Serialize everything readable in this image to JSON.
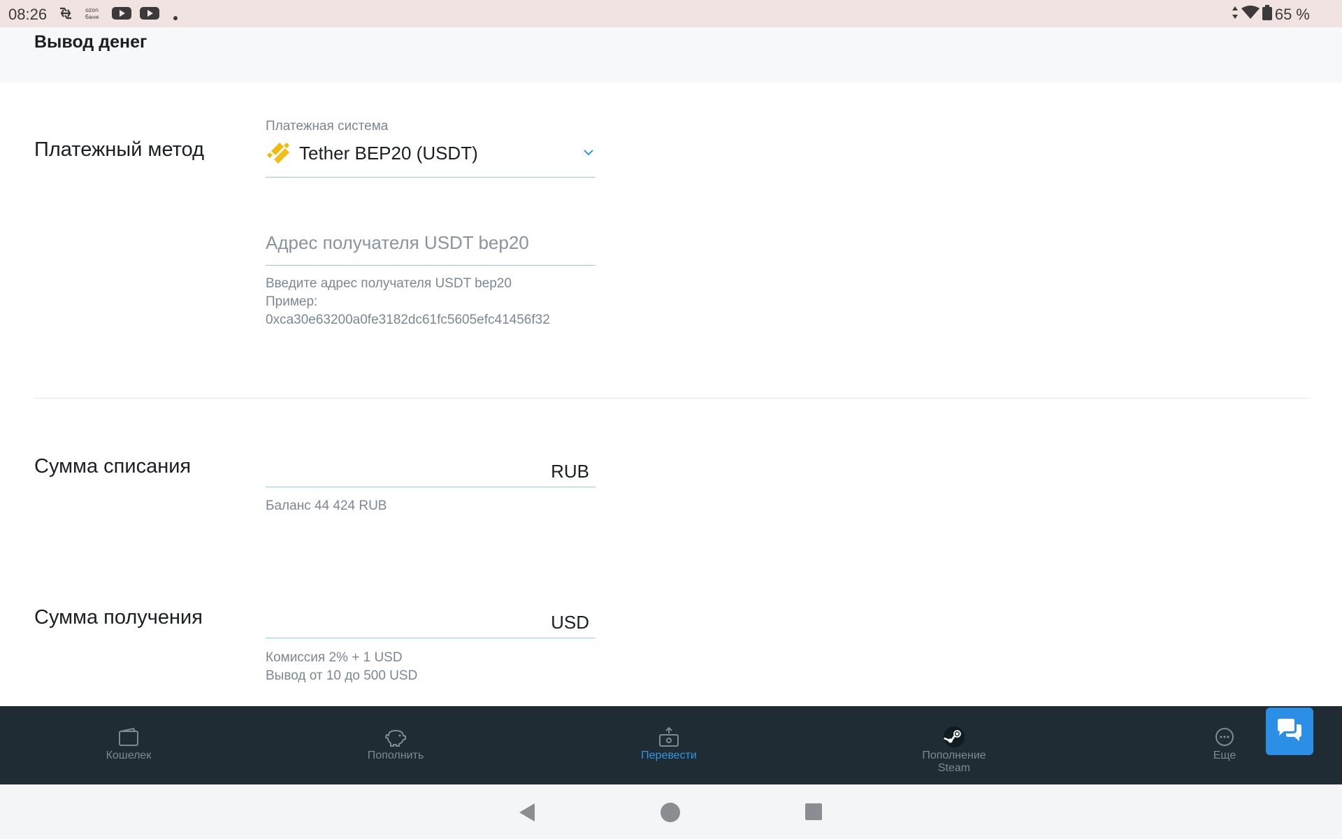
{
  "status_bar": {
    "time": "08:26",
    "left_icons": [
      "sync-icon",
      "ozon-bank-icon",
      "youtube-icon",
      "youtube-icon",
      "dot-icon"
    ],
    "battery": "65 %",
    "right_icons": [
      "data-arrows-icon",
      "wifi-icon",
      "battery-icon"
    ]
  },
  "header": {
    "title": "Вывод денег"
  },
  "payment_method": {
    "label": "Платежный метод",
    "system_label": "Платежная система",
    "system_value": "Tether BEP20 (USDT)",
    "system_icon": "binance-bep20-icon",
    "address_placeholder": "Адрес получателя USDT bep20",
    "address_hint_line1": "Введите адрес получателя USDT bep20",
    "address_hint_line2": "Пример:",
    "address_hint_line3": "0xca30e63200a0fe3182dc61fc5605efc41456f32"
  },
  "debit": {
    "label": "Сумма списания",
    "value": "",
    "currency": "RUB",
    "hint": "Баланс 44 424 RUB"
  },
  "receive": {
    "label": "Сумма получения",
    "value": "",
    "currency": "USD",
    "hint_line1": "Комиссия 2% + 1 USD",
    "hint_line2": "Вывод от 10 до 500 USD"
  },
  "bottom_nav": {
    "items": [
      {
        "label": "Кошелек",
        "icon": "wallet-icon",
        "active": false
      },
      {
        "label": "Пополнить",
        "icon": "piggy-bank-icon",
        "active": false
      },
      {
        "label": "Перевести",
        "icon": "transfer-icon",
        "active": true
      },
      {
        "label_line1": "Пополнение",
        "label_line2": "Steam",
        "icon": "steam-icon",
        "active": false
      },
      {
        "label": "Еще",
        "icon": "more-icon",
        "active": false
      }
    ],
    "chat_icon": "chat-icon"
  },
  "colors": {
    "accent": "#2f97e6",
    "nav_bg": "#1f2c33",
    "field_underline": "#8fcde8",
    "hint_text": "#7b8794",
    "binance_yellow": "#f0b90b"
  }
}
